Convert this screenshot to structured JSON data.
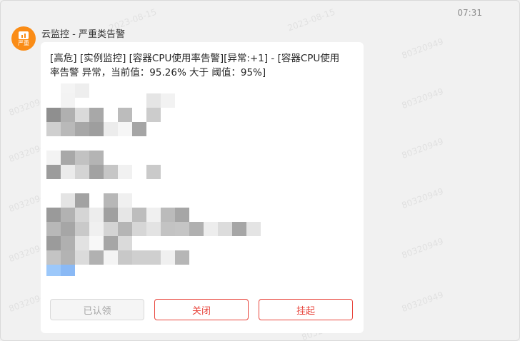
{
  "header": {
    "time": "07:31"
  },
  "sender": {
    "avatar_label": "严重",
    "name": "云监控 - 严重类告警"
  },
  "message": {
    "title": "[高危] [实例监控] [容器CPU使用率告警][异常:+1] - [容器CPU使用率告警 异常，当前值：95.26% 大于 阈值：95%]"
  },
  "actions": {
    "acknowledge": "已认领",
    "close": "关闭",
    "suspend": "挂起"
  },
  "watermark": {
    "ids": [
      "80320949",
      "2023-08-15"
    ]
  },
  "colors": {
    "accent": "#e8453c",
    "avatar": "#fa8c16"
  }
}
